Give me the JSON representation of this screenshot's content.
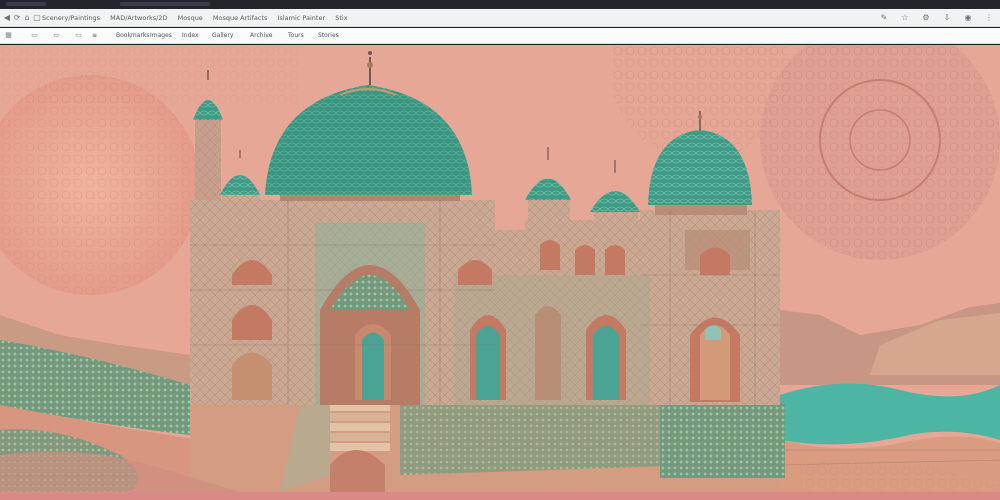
{
  "browser": {
    "window_title": "",
    "url_parts": [
      "Scenery/Paintings",
      "MAD/Artworks/2D",
      "Mosque",
      "Mosque Artifacts",
      "Islamic Painter",
      "Stix"
    ],
    "bookmarks": [
      "Bookmarks",
      "Images",
      "Index",
      "Gallery",
      "Archive",
      "Tours",
      "Stories"
    ]
  },
  "artwork": {
    "sky_color": "#e6a797",
    "dome_color": "#3f9b86",
    "water_color": "#4cb5a4",
    "wall_color": "#c9a890"
  }
}
